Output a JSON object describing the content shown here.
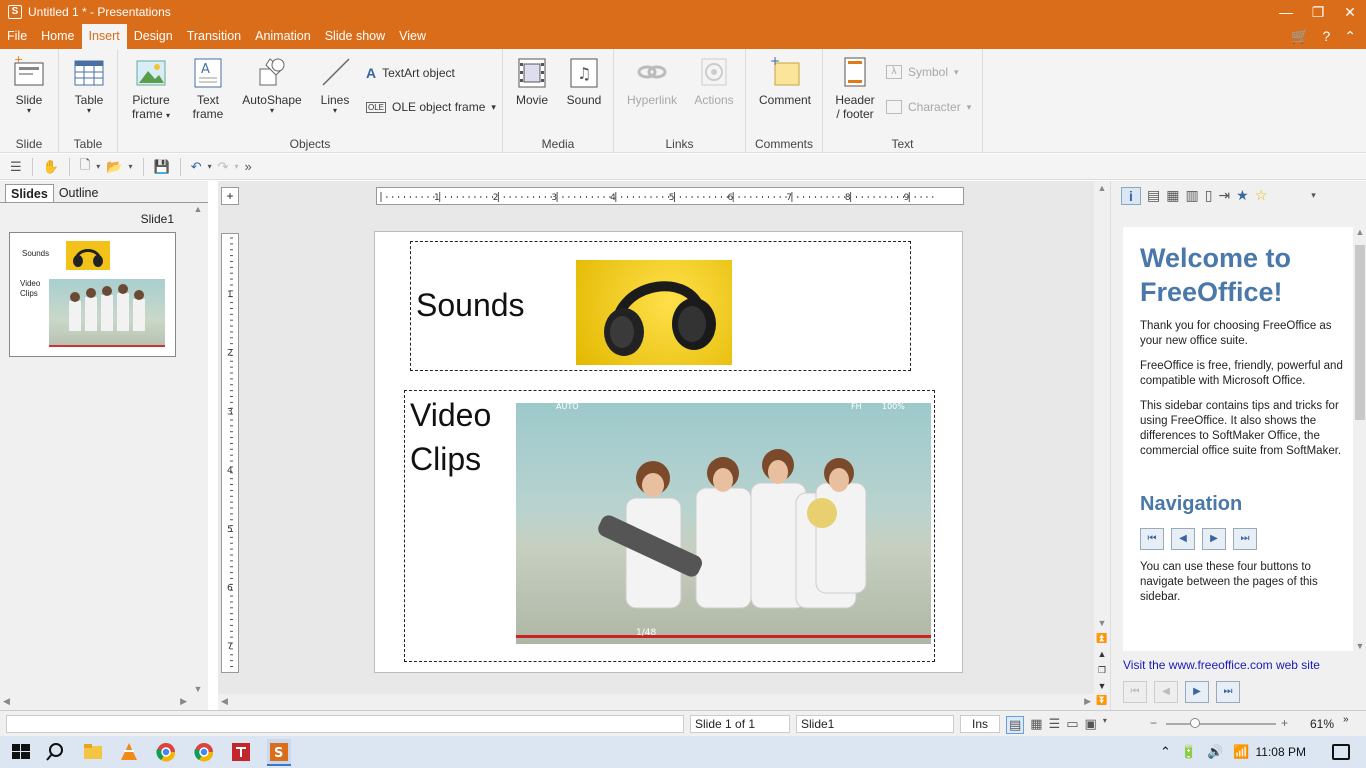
{
  "window": {
    "title": "Untitled 1 * - Presentations",
    "app_icon": "S",
    "controls": {
      "minimize": "—",
      "restore": "❐",
      "close": "✕"
    }
  },
  "menu": {
    "tabs": [
      "File",
      "Home",
      "Insert",
      "Design",
      "Transition",
      "Animation",
      "Slide show",
      "View"
    ],
    "active": "Insert",
    "right_icons": [
      "cart-icon",
      "help-icon",
      "ribbon-collapse-icon"
    ],
    "right_glyphs": [
      "🛒",
      "?",
      "⌃"
    ]
  },
  "ribbon": {
    "groups": {
      "slide": "Slide",
      "table": "Table",
      "objects": "Objects",
      "media": "Media",
      "links": "Links",
      "comments": "Comments",
      "text": "Text"
    },
    "buttons": {
      "slide": "Slide",
      "table": "Table",
      "picture_frame_1": "Picture",
      "picture_frame_2": "frame",
      "text_frame_1": "Text",
      "text_frame_2": "frame",
      "autoshape": "AutoShape",
      "lines": "Lines",
      "textart": "TextArt object",
      "ole": "OLE object frame",
      "movie": "Movie",
      "sound": "Sound",
      "hyperlink": "Hyperlink",
      "actions": "Actions",
      "comment": "Comment",
      "header_1": "Header",
      "header_2": "/ footer",
      "symbol": "Symbol",
      "character": "Character"
    },
    "caret": "▾"
  },
  "quickbar": {
    "icons": [
      "menu-icon",
      "hand-icon",
      "new-document-icon",
      "open-icon",
      "save-icon",
      "undo-icon",
      "redo-icon",
      "more-icon"
    ],
    "glyphs": [
      "☰",
      "✋",
      "🗋",
      "📂",
      "💾",
      "↶",
      "↷",
      "»"
    ]
  },
  "left_panel": {
    "tabs": [
      "Slides",
      "Outline"
    ],
    "active_tab": "Slides",
    "slide_label": "Slide1",
    "thumb_sounds": "Sounds",
    "thumb_video_1": "Video",
    "thumb_video_2": "Clips"
  },
  "slide": {
    "sounds_label": "Sounds",
    "video_label_1": "Video",
    "video_label_2": "Clips",
    "video_overlay": {
      "tl": "AUTO",
      "tr1": "FH",
      "tr2": "100%",
      "bottom": "1/48"
    }
  },
  "ruler": {
    "h_numbers": [
      "1",
      "2",
      "3",
      "4",
      "5",
      "6",
      "7",
      "8",
      "9"
    ],
    "v_numbers": [
      "1",
      "2",
      "3",
      "4",
      "5",
      "6",
      "7"
    ]
  },
  "sidebar": {
    "title": "Welcome to FreeOffice!",
    "p1": "Thank you for choosing FreeOffice as your new office suite.",
    "p2": "FreeOffice is free, friendly, powerful and compatible with Microsoft Office.",
    "p3": "This sidebar contains tips and tricks for using FreeOffice. It also shows the differences to SoftMaker Office, the commercial office suite from SoftMaker.",
    "nav_title": "Navigation",
    "p4": "You can use these four buttons to navigate between the pages of this sidebar.",
    "link": "Visit the www.freeoffice.com web site",
    "nav_glyphs": [
      "⏮",
      "◀",
      "▶",
      "⏭"
    ],
    "toolbar_icons": [
      "info-icon",
      "table-icon",
      "doc-icon",
      "chart-icon",
      "layout-icon",
      "export-icon",
      "star-blue-icon",
      "star-yellow-icon",
      "dropdown-icon"
    ]
  },
  "status": {
    "slide_pos": "Slide 1 of 1",
    "slide_name": "Slide1",
    "mode": "Ins",
    "zoom": "61%",
    "zoom_minus": "−",
    "zoom_plus": "+"
  },
  "taskbar": {
    "time": "11:08 PM",
    "tray_glyphs": [
      "⌃",
      "🔋",
      "🔊",
      "📶"
    ]
  },
  "colors": {
    "accent": "#d96d1a",
    "sidebar_heading": "#4a78a8",
    "link": "#1a1ab8"
  }
}
